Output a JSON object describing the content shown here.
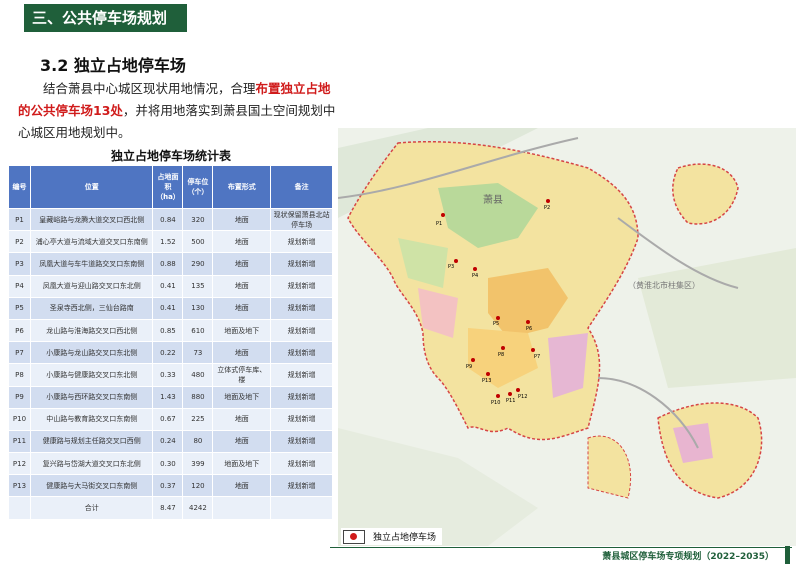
{
  "header": {
    "title": "三、公共停车场规划"
  },
  "section": {
    "title": "3.2 独立占地停车场"
  },
  "intro": {
    "part1": "结合萧县中心城区现状用地情况，合理",
    "highlight": "布置独立占地的公共停车场13处",
    "part2": "，并将用地落实到萧县国土空间规划中心城区用地规划中。"
  },
  "table": {
    "title": "独立占地停车场统计表",
    "headers": [
      "编号",
      "位置",
      "占地面积（ha）",
      "停车位（个）",
      "布置形式",
      "备注"
    ],
    "rows": [
      [
        "P1",
        "皇藏峪路与龙腾大道交叉口西北侧",
        "0.84",
        "320",
        "地面",
        "现状保留萧县北站停车场"
      ],
      [
        "P2",
        "浦心亭大道与流域大道交叉口东南侧",
        "1.52",
        "500",
        "地面",
        "规划新增"
      ],
      [
        "P3",
        "凤凰大道与车牛道路交叉口东南侧",
        "0.88",
        "290",
        "地面",
        "规划新增"
      ],
      [
        "P4",
        "凤凰大道与迎山路交叉口东北侧",
        "0.41",
        "135",
        "地面",
        "规划新增"
      ],
      [
        "P5",
        "圣泉寺西北侧，三仙台路南",
        "0.41",
        "130",
        "地面",
        "规划新增"
      ],
      [
        "P6",
        "龙山路与淮海路交叉口西北侧",
        "0.85",
        "610",
        "地面及地下",
        "规划新增"
      ],
      [
        "P7",
        "小康路与龙山路交叉口东北侧",
        "0.22",
        "73",
        "地面",
        "规划新增"
      ],
      [
        "P8",
        "小康路与健康路交叉口东北侧",
        "0.33",
        "480",
        "立体式停车库、楼",
        "规划新增"
      ],
      [
        "P9",
        "小康路与西环路交叉口东南侧",
        "1.43",
        "880",
        "地面及地下",
        "规划新增"
      ],
      [
        "P10",
        "中山路与教育路交叉口东南侧",
        "0.67",
        "225",
        "地面",
        "规划新增"
      ],
      [
        "P11",
        "健康路与规划主任路交叉口西侧",
        "0.24",
        "80",
        "地面",
        "规划新增"
      ],
      [
        "P12",
        "复兴路与岱湖大道交叉口东北侧",
        "0.30",
        "399",
        "地面及地下",
        "规划新增"
      ],
      [
        "P13",
        "健康路与大马街交叉口东南侧",
        "0.37",
        "120",
        "地面",
        "规划新增"
      ]
    ],
    "total": {
      "label": "合计",
      "area": "8.47",
      "spaces": "4242"
    }
  },
  "map": {
    "labels": {
      "county": "萧县",
      "district": "（黄淮北市柱集区）"
    },
    "parking_labels": [
      "P1",
      "P2",
      "P3",
      "P4",
      "P5",
      "P6",
      "P7",
      "P8",
      "P9",
      "P10",
      "P11",
      "P12",
      "P13"
    ]
  },
  "legend": {
    "label": "独立占地停车场"
  },
  "footer": {
    "title": "萧县城区停车场专项规划（2022–2035）"
  },
  "colors": {
    "header_bg": "#1f5f3a",
    "table_header": "#4f75c2",
    "highlight": "#d01b1b"
  }
}
